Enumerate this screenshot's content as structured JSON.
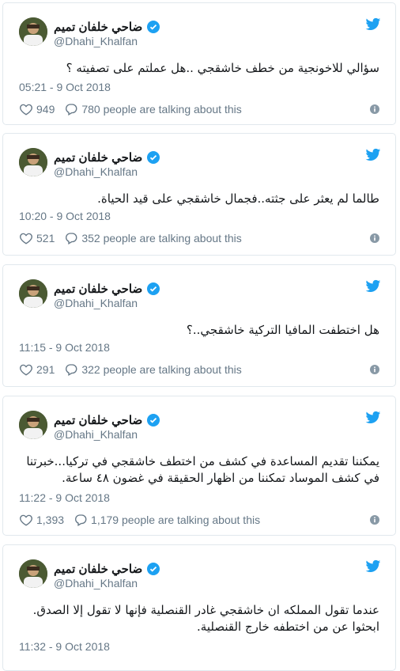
{
  "tweets": [
    {
      "name": "ضاحي خلفان تميم",
      "handle": "@Dhahi_Khalfan",
      "text": "سؤالي للاخونجية  من خطف خاشقجي ..هل عملتم على تصفيته ؟",
      "time": "05:21 - 9 Oct 2018",
      "likes": "949",
      "talking": "780 people are talking about this"
    },
    {
      "name": "ضاحي خلفان تميم",
      "handle": "@Dhahi_Khalfan",
      "text": "طالما لم يعثر على جثته..فجمال خاشقجي على قيد الحياة.",
      "time": "10:20 - 9 Oct 2018",
      "likes": "521",
      "talking": "352 people are talking about this"
    },
    {
      "name": "ضاحي خلفان تميم",
      "handle": "@Dhahi_Khalfan",
      "text": "هل اختطفت المافيا التركية خاشقجي..؟",
      "time": "11:15 - 9 Oct 2018",
      "likes": "291",
      "talking": "322 people are talking about this"
    },
    {
      "name": "ضاحي خلفان تميم",
      "handle": "@Dhahi_Khalfan",
      "text": "يمكننا تقديم المساعدة في كشف من اختطف خاشقجي في تركيا...خبرتنا في كشف الموساد تمكننا من اظهار الحقيقة في غضون ٤٨  ساعة.",
      "time": "11:22 - 9 Oct 2018",
      "likes": "1,393",
      "talking": "1,179 people are talking about this"
    },
    {
      "name": "ضاحي خلفان تميم",
      "handle": "@Dhahi_Khalfan",
      "text": "عندما تقول المملكه ان خاشقجي غادر القنصلية فإنها لا تقول إلا الصدق. ابحثوا عن من اختطفه خارج القنصلية.",
      "time": "11:32 - 9 Oct 2018",
      "likes": "",
      "talking": ""
    }
  ],
  "colors": {
    "twitter_blue": "#1da1f2",
    "secondary_text": "#657786",
    "border": "#e1e8ed"
  },
  "icons": [
    "twitter-bird-icon",
    "verified-badge-icon",
    "heart-icon",
    "speech-bubble-icon",
    "info-icon"
  ]
}
